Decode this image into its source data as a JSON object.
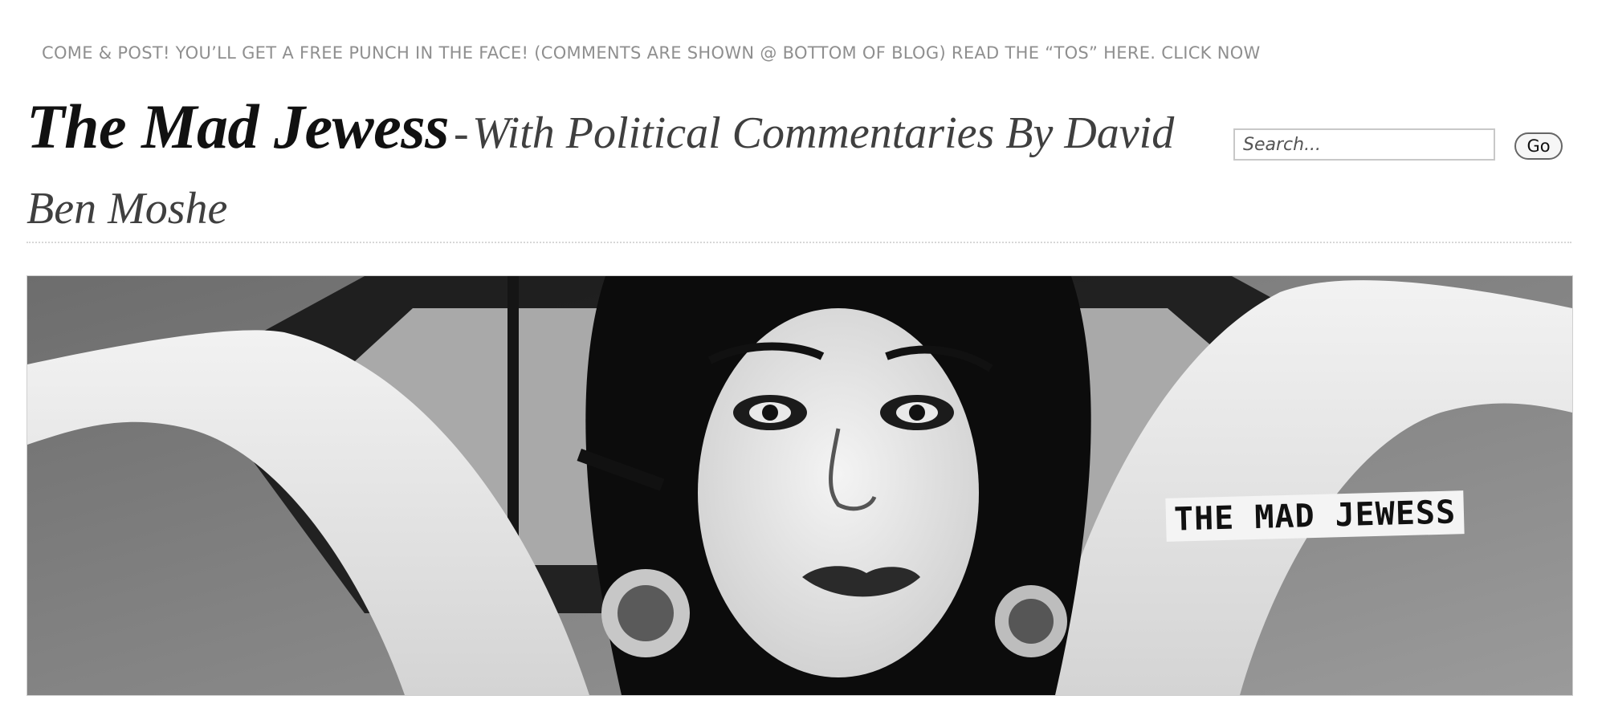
{
  "topbar": {
    "text": "COME & POST! YOU’LL GET A FREE PUNCH IN THE FACE! (COMMENTS ARE SHOWN @ BOTTOM OF BLOG) READ THE “TOS” HERE. CLICK NOW"
  },
  "header": {
    "title": "The Mad Jewess",
    "separator": "-",
    "tagline": "With Political Commentaries By David Ben Moshe"
  },
  "search": {
    "placeholder": "Search...",
    "button_label": "Go"
  },
  "banner": {
    "label": "THE MAD JEWESS"
  }
}
